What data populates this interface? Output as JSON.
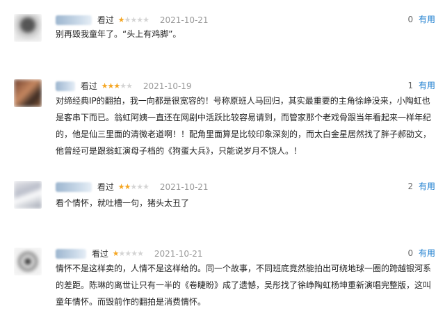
{
  "reviews": [
    {
      "action": "看过",
      "rating": 1,
      "date": "2021-10-21",
      "useful_count": "0",
      "useful_label": "有用",
      "text": "别再毁我童年了。“头上有鸡脚”。"
    },
    {
      "action": "看过",
      "rating": 3,
      "date": "2021-10-19",
      "useful_count": "1",
      "useful_label": "有用",
      "text": "对缔经典IP的翻拍，我一向都是很宽容的！号称原班人马回归，其实最重要的主角徐峥没来，小陶虹也是客串下而已。翁虹阿姨一直还在网剧中活跃比较容易请到，而管家那个老戏骨跟当年看起来一样年纪的，他是仙三里面的清微老道啊！！配角里面算是比较印象深刻的，而太白金星居然找了胖子郝劭文，他曾经可是跟翁虹演母子档的《狗蛋大兵》，只能说岁月不饶人。！"
    },
    {
      "action": "看过",
      "rating": 2,
      "date": "2021-10-21",
      "useful_count": "2",
      "useful_label": "有用",
      "text": "看个情怀，就吐槽一句，猪头太丑了"
    },
    {
      "action": "看过",
      "rating": 1,
      "date": "2021-10-21",
      "useful_count": "0",
      "useful_label": "有用",
      "text": "情怀不是这样卖的，人情不是这样给的。同一个故事，不同班底竟然能拍出可绕地球一圈的跨越银河系的差距。陈琳的离世让只有一半的《卷睫盼》成了遗憾，吴彤找了徐峥陶虹杨坤重新演唱完整版，这叫童年情怀。而毁前作的翻拍是消费情怀。"
    }
  ]
}
